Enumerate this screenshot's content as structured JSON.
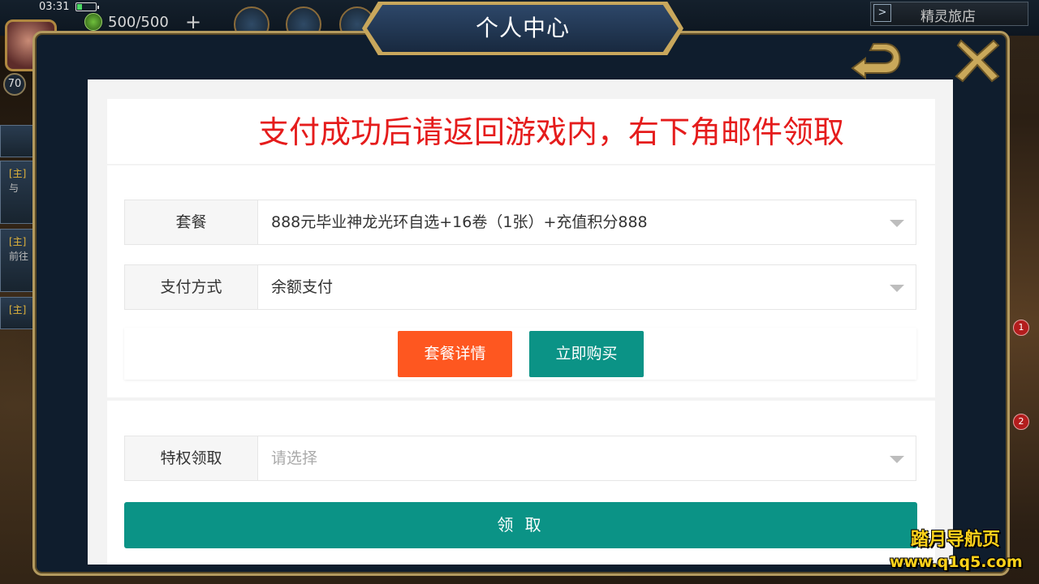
{
  "status_bar": {
    "time": "03:31"
  },
  "game_hud": {
    "energy": "500/500",
    "plus": "+",
    "level": "70",
    "inn_button": "精灵旅店",
    "inn_arrow": ">",
    "left_tabs": [
      {
        "tag": "[主]",
        "text": "与"
      },
      {
        "tag": "[主]",
        "text": "前往"
      },
      {
        "tag": "[主]",
        "text": ""
      }
    ],
    "right_badges": [
      "1",
      "2"
    ]
  },
  "modal": {
    "title": "个人中心",
    "back_icon": "back-arrow-icon",
    "close_icon": "close-x-icon"
  },
  "page": {
    "notice": "支付成功后请返回游戏内，右下角邮件领取",
    "package": {
      "label": "套餐",
      "value": "888元毕业神龙光环自选+16卷（1张）+充值积分888"
    },
    "payment": {
      "label": "支付方式",
      "value": "余额支付"
    },
    "details_button": "套餐详情",
    "buy_button": "立即购买",
    "privilege": {
      "label": "特权领取",
      "placeholder": "请选择"
    },
    "claim_button": "领 取"
  },
  "watermark": {
    "line1": "踏月导航页",
    "line2": "www.q1q5.com"
  },
  "colors": {
    "notice_red": "#e51c1c",
    "orange_button": "#fe5720",
    "teal_button": "#0b9386",
    "frame_gold": "#b39a5f",
    "frame_navy": "#0f1d2d",
    "watermark_yellow": "#ffd21a"
  }
}
